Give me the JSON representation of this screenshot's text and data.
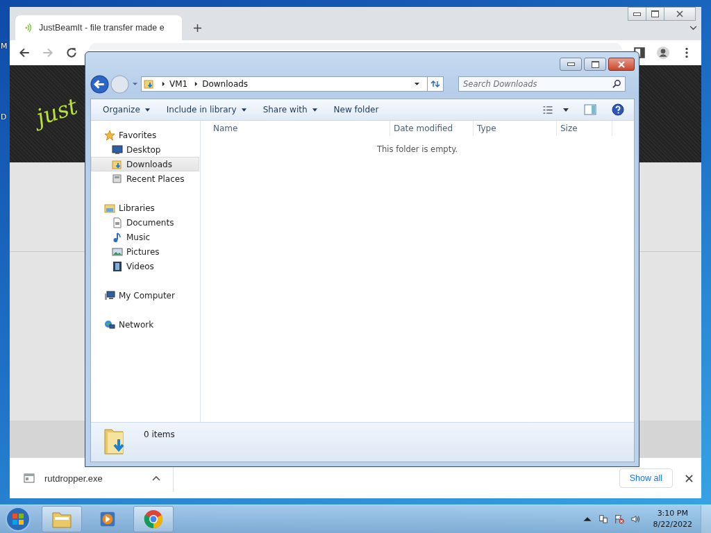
{
  "desktop": {
    "icon_labels": [
      "M",
      "D"
    ]
  },
  "browser": {
    "tabs": [
      {
        "title": "JustBeamIt - file transfer made e",
        "selected": true
      }
    ],
    "page": {
      "logo_text": "just"
    },
    "download_shelf": {
      "items": [
        {
          "file_name": "rutdropper.exe"
        }
      ],
      "show_all": "Show all"
    }
  },
  "explorer": {
    "breadcrumbs": [
      "VM1",
      "Downloads"
    ],
    "search": {
      "placeholder": "Search Downloads"
    },
    "toolbar": [
      {
        "label": "Organize",
        "dropdown": true
      },
      {
        "label": "Include in library",
        "dropdown": true
      },
      {
        "label": "Share with",
        "dropdown": true
      },
      {
        "label": "New folder",
        "dropdown": false
      }
    ],
    "nav": [
      {
        "label": "Favorites",
        "kind": "star",
        "selected": false,
        "children": [
          {
            "label": "Desktop",
            "kind": "desktop",
            "selected": false
          },
          {
            "label": "Downloads",
            "kind": "downloads",
            "selected": true
          },
          {
            "label": "Recent Places",
            "kind": "recent",
            "selected": false
          }
        ]
      },
      {
        "label": "Libraries",
        "kind": "libraries",
        "selected": false,
        "children": [
          {
            "label": "Documents",
            "kind": "documents",
            "selected": false
          },
          {
            "label": "Music",
            "kind": "music",
            "selected": false
          },
          {
            "label": "Pictures",
            "kind": "pictures",
            "selected": false
          },
          {
            "label": "Videos",
            "kind": "videos",
            "selected": false
          }
        ]
      },
      {
        "label": "My Computer",
        "kind": "computer",
        "selected": false
      },
      {
        "label": "Network",
        "kind": "network",
        "selected": false
      }
    ],
    "columns": [
      "Name",
      "Date modified",
      "Type",
      "Size"
    ],
    "empty_message": "This folder is empty.",
    "status": "0 items"
  },
  "taskbar": {
    "apps": [
      {
        "kind": "explorer",
        "running": true
      },
      {
        "kind": "media",
        "running": false
      },
      {
        "kind": "chrome",
        "running": true
      }
    ],
    "clock": {
      "time": "3:10 PM",
      "date": "8/22/2022"
    }
  }
}
